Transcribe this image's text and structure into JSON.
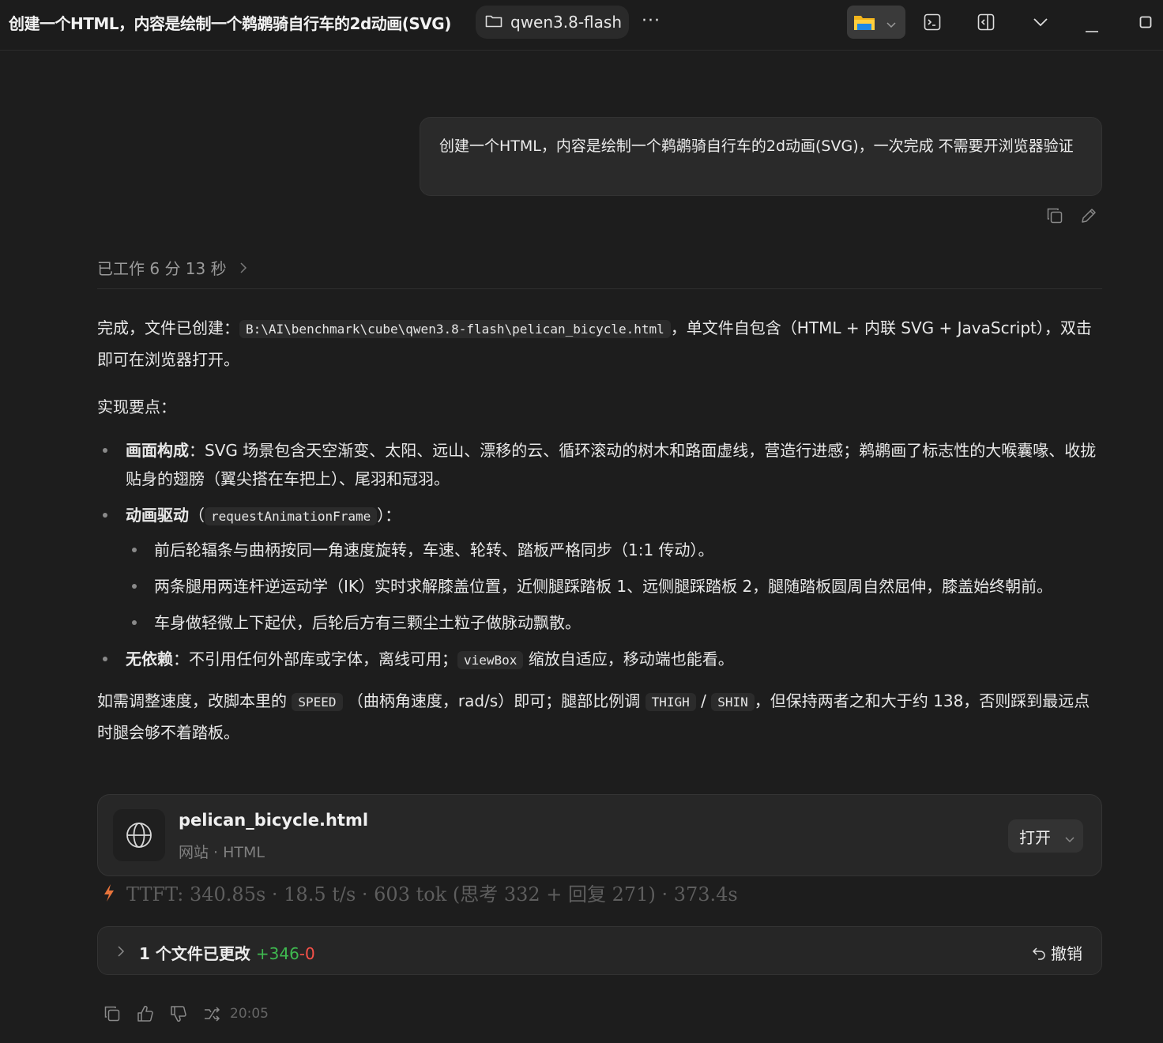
{
  "window": {
    "title": "创建一个HTML，内容是绘制一个鹈鹕骑自行车的2d动画(SVG)",
    "project": "qwen3.8-flash",
    "more": "···"
  },
  "user_message": "创建一个HTML，内容是绘制一个鹈鹕骑自行车的2d动画(SVG)，一次完成 不需要开浏览器验证",
  "worked": "已工作 6 分 13 秒",
  "response": {
    "intro_before": "完成，文件已创建：",
    "file_path": "B:\\AI\\benchmark\\cube\\qwen3.8-flash\\pelican_bicycle.html",
    "intro_after": "，单文件自包含（HTML + 内联 SVG + JavaScript），双击即可在浏览器打开。",
    "points_title": "实现要点：",
    "b1_label": "画面构成",
    "b1_text": "：SVG 场景包含天空渐变、太阳、远山、漂移的云、循环滚动的树木和路面虚线，营造行进感；鹈鹕画了标志性的大喉囊喙、收拢贴身的翅膀（翼尖搭在车把上）、尾羽和冠羽。",
    "b2_label": "动画驱动",
    "b2_open": "（",
    "b2_code": "requestAnimationFrame",
    "b2_close": "）：",
    "b2_sub1": "前后轮辐条与曲柄按同一角速度旋转，车速、轮转、踏板严格同步（1:1 传动）。",
    "b2_sub2": "两条腿用两连杆逆运动学（IK）实时求解膝盖位置，近侧腿踩踏板 1、远侧腿踩踏板 2，腿随踏板圆周自然屈伸，膝盖始终朝前。",
    "b2_sub3": "车身做轻微上下起伏，后轮后方有三颗尘土粒子做脉动飘散。",
    "b3_label": "无依赖",
    "b3_text1": "：不引用任何外部库或字体，离线可用；",
    "b3_code": "viewBox",
    "b3_text2": "缩放自适应，移动端也能看。",
    "outro_1": "如需调整速度，改脚本里的",
    "outro_code1": "SPEED",
    "outro_2": "（曲柄角速度，rad/s）即可；腿部比例调",
    "outro_code2": "THIGH",
    "outro_slash": "/",
    "outro_code3": "SHIN",
    "outro_3": "，但保持两者之和大于约 138，否则踩到最远点时腿会够不着踏板。"
  },
  "file_card": {
    "name": "pelican_bicycle.html",
    "meta": "网站 · HTML",
    "open_label": "打开"
  },
  "stats": "TTFT: 340.85s · 18.5 t/s · 603 tok (思考 332 + 回复 271) · 373.4s",
  "changes": {
    "label": "1 个文件已更改",
    "added": "+346",
    "removed": "-0",
    "undo": "撤销"
  },
  "footer": {
    "time": "20:05"
  },
  "colors": {
    "added": "#3fb950",
    "removed": "#f85149",
    "bolt": "#e8743b",
    "background": "#1d1d1d"
  }
}
